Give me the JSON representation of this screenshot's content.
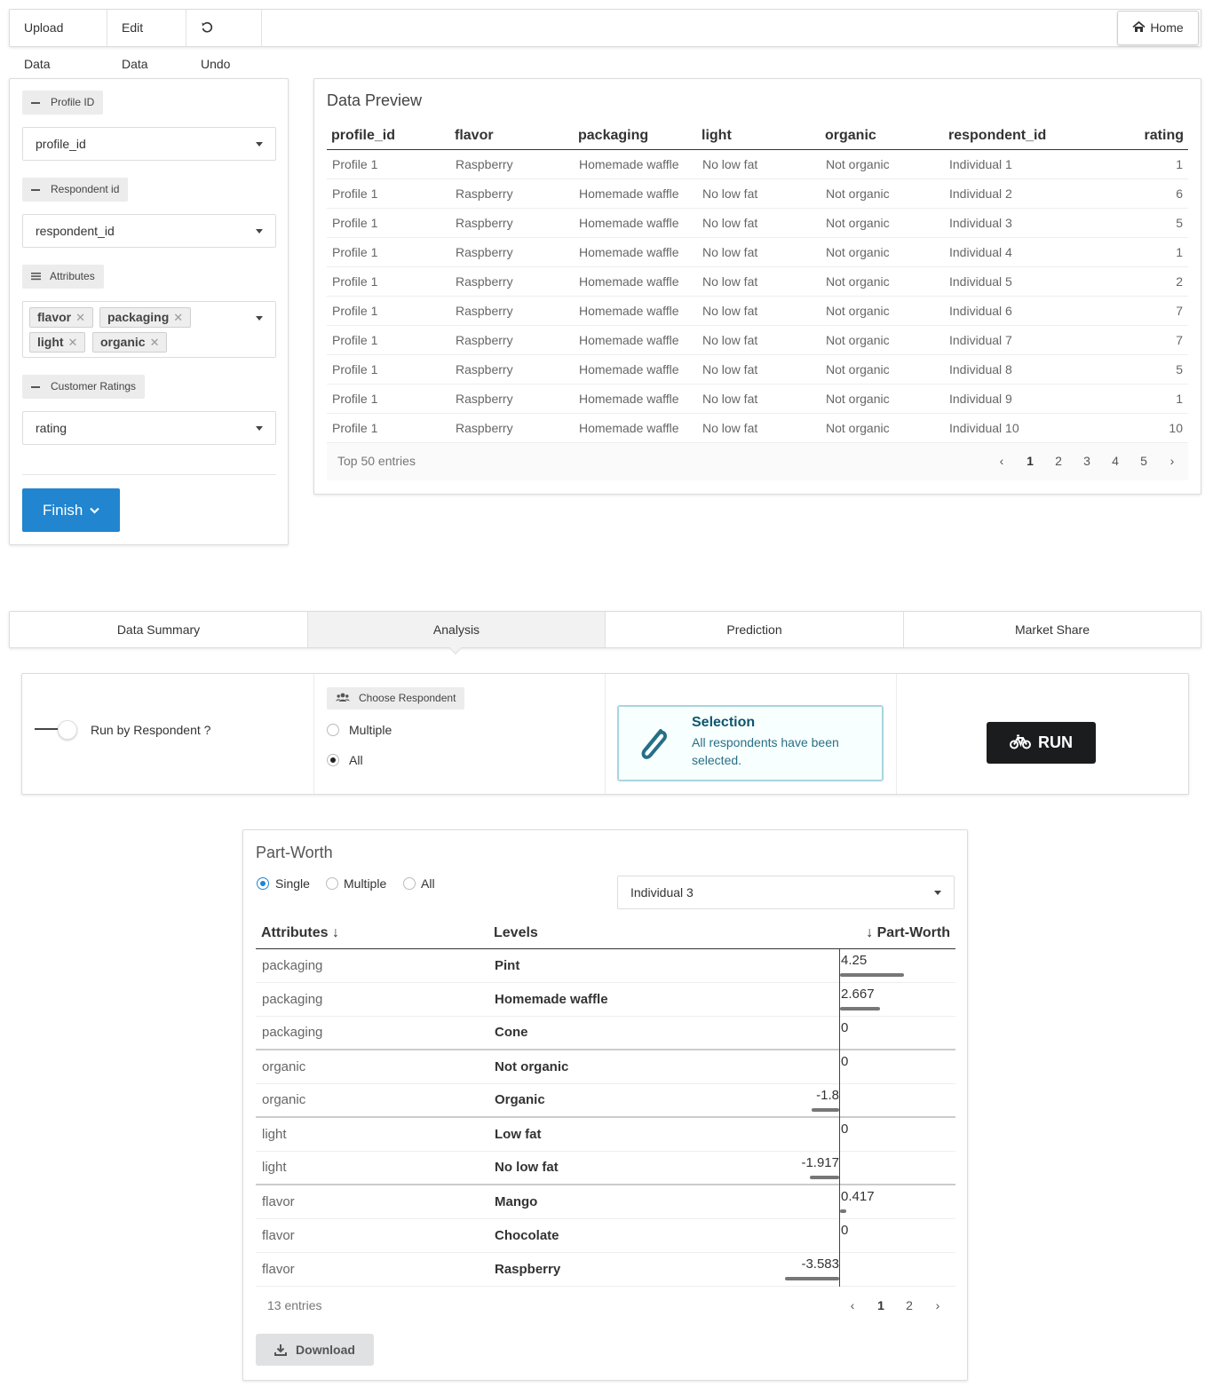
{
  "toolbar": {
    "upload_label": "Upload Data",
    "edit_label": "Edit Data",
    "undo_label": "Undo",
    "home_label": "Home"
  },
  "settings": {
    "profile_label": "Profile ID",
    "profile_value": "profile_id",
    "respondent_label": "Respondent id",
    "respondent_value": "respondent_id",
    "attributes_label": "Attributes",
    "attribute_tags": [
      "flavor",
      "packaging",
      "light",
      "organic"
    ],
    "ratings_label": "Customer Ratings",
    "ratings_value": "rating",
    "finish_label": "Finish"
  },
  "preview": {
    "title": "Data Preview",
    "columns": [
      "profile_id",
      "flavor",
      "packaging",
      "light",
      "organic",
      "respondent_id",
      "rating"
    ],
    "rows": [
      [
        "Profile 1",
        "Raspberry",
        "Homemade waffle",
        "No low fat",
        "Not organic",
        "Individual 1",
        "1"
      ],
      [
        "Profile 1",
        "Raspberry",
        "Homemade waffle",
        "No low fat",
        "Not organic",
        "Individual 2",
        "6"
      ],
      [
        "Profile 1",
        "Raspberry",
        "Homemade waffle",
        "No low fat",
        "Not organic",
        "Individual 3",
        "5"
      ],
      [
        "Profile 1",
        "Raspberry",
        "Homemade waffle",
        "No low fat",
        "Not organic",
        "Individual 4",
        "1"
      ],
      [
        "Profile 1",
        "Raspberry",
        "Homemade waffle",
        "No low fat",
        "Not organic",
        "Individual 5",
        "2"
      ],
      [
        "Profile 1",
        "Raspberry",
        "Homemade waffle",
        "No low fat",
        "Not organic",
        "Individual 6",
        "7"
      ],
      [
        "Profile 1",
        "Raspberry",
        "Homemade waffle",
        "No low fat",
        "Not organic",
        "Individual 7",
        "7"
      ],
      [
        "Profile 1",
        "Raspberry",
        "Homemade waffle",
        "No low fat",
        "Not organic",
        "Individual 8",
        "5"
      ],
      [
        "Profile 1",
        "Raspberry",
        "Homemade waffle",
        "No low fat",
        "Not organic",
        "Individual 9",
        "1"
      ],
      [
        "Profile 1",
        "Raspberry",
        "Homemade waffle",
        "No low fat",
        "Not organic",
        "Individual 10",
        "10"
      ]
    ],
    "footer": "Top 50 entries",
    "pages": [
      "1",
      "2",
      "3",
      "4",
      "5"
    ],
    "current_page": "1"
  },
  "tabs": {
    "items": [
      "Data Summary",
      "Analysis",
      "Prediction",
      "Market Share"
    ],
    "active": "Analysis"
  },
  "analysis": {
    "toggle_label": "Run by Respondent ?",
    "choose_label": "Choose Respondent",
    "option_multiple": "Multiple",
    "option_all": "All",
    "selected_option": "All",
    "message_title": "Selection",
    "message_body": "All respondents have been selected.",
    "run_label": "RUN"
  },
  "partworth": {
    "title": "Part-Worth",
    "mode_options": [
      "Single",
      "Multiple",
      "All"
    ],
    "mode_selected": "Single",
    "respondent_value": "Individual 3",
    "columns": [
      "Attributes ↓",
      "Levels",
      "↓ Part-Worth"
    ],
    "rows": [
      {
        "attribute": "packaging",
        "level": "Pint",
        "value": 4.25,
        "label": "4.25"
      },
      {
        "attribute": "packaging",
        "level": "Homemade waffle",
        "value": 2.667,
        "label": "2.667"
      },
      {
        "attribute": "packaging",
        "level": "Cone",
        "value": 0,
        "label": "0"
      },
      {
        "attribute": "organic",
        "level": "Not organic",
        "value": 0,
        "label": "0"
      },
      {
        "attribute": "organic",
        "level": "Organic",
        "value": -1.8,
        "label": "-1.8"
      },
      {
        "attribute": "light",
        "level": "Low fat",
        "value": 0,
        "label": "0"
      },
      {
        "attribute": "light",
        "level": "No low fat",
        "value": -1.917,
        "label": "-1.917"
      },
      {
        "attribute": "flavor",
        "level": "Mango",
        "value": 0.417,
        "label": "0.417"
      },
      {
        "attribute": "flavor",
        "level": "Chocolate",
        "value": 0,
        "label": "0"
      },
      {
        "attribute": "flavor",
        "level": "Raspberry",
        "value": -3.583,
        "label": "-3.583"
      }
    ],
    "footer": "13 entries",
    "pages": [
      "1",
      "2"
    ],
    "current_page": "1",
    "download_label": "Download"
  }
}
